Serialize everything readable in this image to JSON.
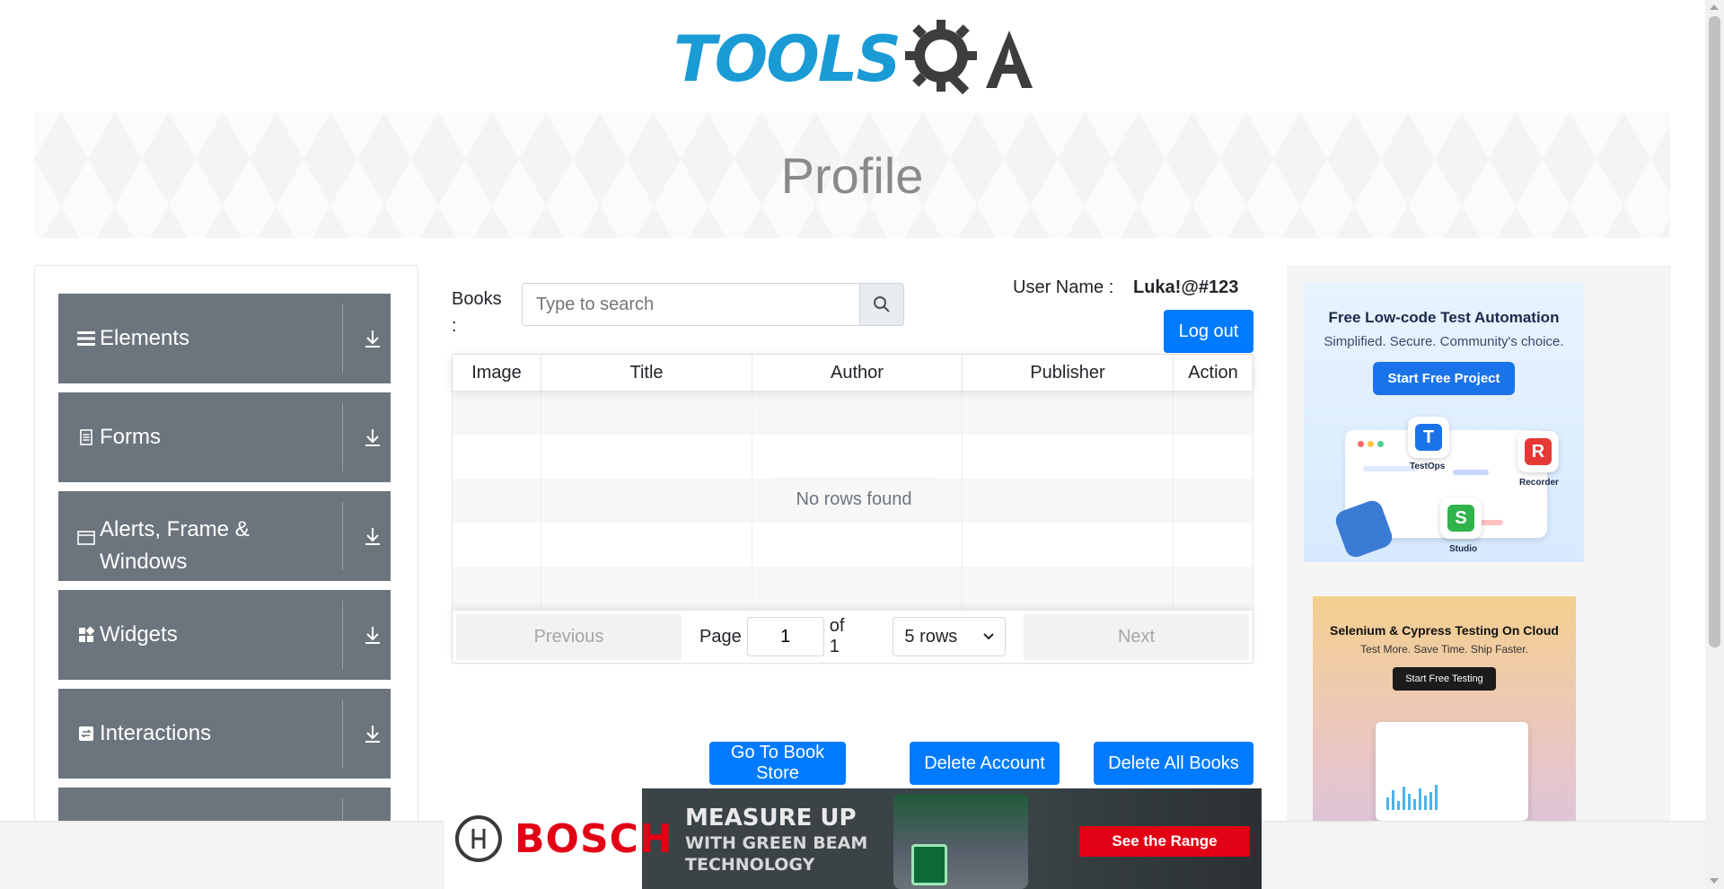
{
  "header": {
    "logo_text": "TOOLS",
    "logo_qa": "QA"
  },
  "banner": {
    "title": "Profile"
  },
  "sidebar": {
    "groups": [
      {
        "label": "Elements",
        "icon": "hamburger-icon"
      },
      {
        "label": "Forms",
        "icon": "document-icon"
      },
      {
        "label": "Alerts, Frame & Windows",
        "icon": "window-icon"
      },
      {
        "label": "Widgets",
        "icon": "widgets-icon"
      },
      {
        "label": "Interactions",
        "icon": "interactions-icon"
      },
      {
        "label": "",
        "icon": ""
      }
    ]
  },
  "books": {
    "label": "Books :",
    "search_placeholder": "Type to search"
  },
  "user": {
    "label": "User Name :",
    "value": "Luka!@#123",
    "logout": "Log out"
  },
  "table": {
    "columns": [
      "Image",
      "Title",
      "Author",
      "Publisher",
      "Action"
    ],
    "empty_text": "No rows found",
    "previous": "Previous",
    "next": "Next",
    "page_label": "Page",
    "page_value": "1",
    "of_label": "of 1",
    "rows_selected": "5 rows"
  },
  "actions": {
    "book_store": "Go To Book Store",
    "delete_account": "Delete Account",
    "delete_books": "Delete All Books"
  },
  "ads": {
    "ad1": {
      "title": "Free Low-code Test Automation",
      "subtitle": "Simplified. Secure. Community's choice.",
      "button": "Start Free Project",
      "chip_testops": "TestOps",
      "chip_recorder": "Recorder",
      "chip_studio": "Studio"
    },
    "ad2": {
      "title": "Selenium & Cypress Testing On Cloud",
      "subtitle": "Test More. Save Time. Ship Faster.",
      "button": "Start Free Testing"
    },
    "bosch": {
      "brand": "BOSCH",
      "line1": "MEASURE UP",
      "line2": "WITH GREEN BEAM",
      "line3": "TECHNOLOGY",
      "cta": "See the Range"
    }
  },
  "colors": {
    "primary": "#007bff",
    "sidebar": "#6c757d",
    "logo_blue": "#1a9bd6",
    "bosch_red": "#e20015"
  }
}
